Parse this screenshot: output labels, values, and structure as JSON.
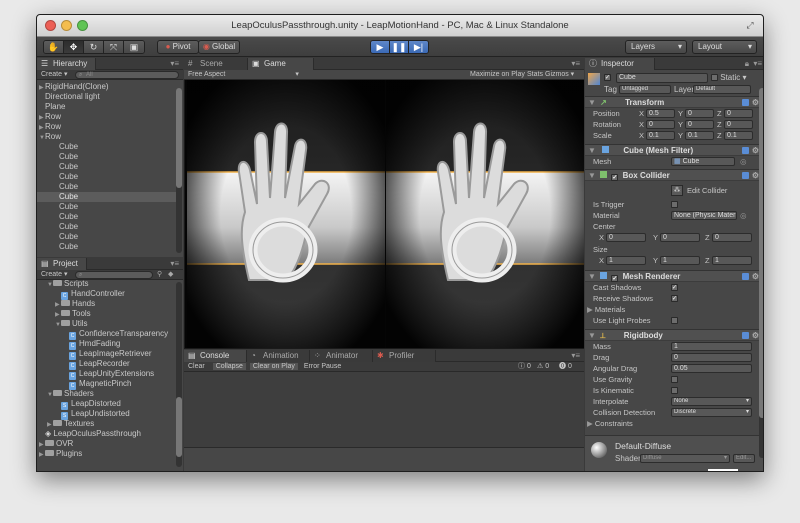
{
  "window": {
    "title": "LeapOculusPassthrough.unity - LeapMotionHand - PC, Mac & Linux Standalone"
  },
  "toolbar": {
    "pivot": "Pivot",
    "global": "Global",
    "layers": "Layers",
    "layout": "Layout",
    "tools": [
      "hand-icon",
      "move-icon",
      "rotate-icon",
      "scale-icon",
      "rect-icon"
    ],
    "play": [
      "play-icon",
      "pause-icon",
      "step-icon"
    ]
  },
  "hierarchy": {
    "tab": "Hierarchy",
    "create": "Create",
    "search_placeholder": "All",
    "items": [
      {
        "label": "RigidHand(Clone)",
        "indent": 0,
        "arrow": "▶",
        "selected": false
      },
      {
        "label": "Directional light",
        "indent": 0,
        "arrow": "",
        "selected": false
      },
      {
        "label": "Plane",
        "indent": 0,
        "arrow": "",
        "selected": false
      },
      {
        "label": "Row",
        "indent": 0,
        "arrow": "▶",
        "selected": false
      },
      {
        "label": "Row",
        "indent": 0,
        "arrow": "▶",
        "selected": false
      },
      {
        "label": "Row",
        "indent": 0,
        "arrow": "▼",
        "selected": false
      },
      {
        "label": "Cube",
        "indent": 1,
        "arrow": "",
        "selected": false
      },
      {
        "label": "Cube",
        "indent": 1,
        "arrow": "",
        "selected": false
      },
      {
        "label": "Cube",
        "indent": 1,
        "arrow": "",
        "selected": false
      },
      {
        "label": "Cube",
        "indent": 1,
        "arrow": "",
        "selected": false
      },
      {
        "label": "Cube",
        "indent": 1,
        "arrow": "",
        "selected": false
      },
      {
        "label": "Cube",
        "indent": 1,
        "arrow": "",
        "selected": true
      },
      {
        "label": "Cube",
        "indent": 1,
        "arrow": "",
        "selected": false
      },
      {
        "label": "Cube",
        "indent": 1,
        "arrow": "",
        "selected": false
      },
      {
        "label": "Cube",
        "indent": 1,
        "arrow": "",
        "selected": false
      },
      {
        "label": "Cube",
        "indent": 1,
        "arrow": "",
        "selected": false
      },
      {
        "label": "Cube",
        "indent": 1,
        "arrow": "",
        "selected": false
      }
    ]
  },
  "project": {
    "tab": "Project",
    "create": "Create",
    "items": [
      {
        "label": "Scripts",
        "depth": 1,
        "arrow": "▼",
        "kind": "folder"
      },
      {
        "label": "HandController",
        "depth": 2,
        "arrow": "",
        "kind": "script"
      },
      {
        "label": "Hands",
        "depth": 2,
        "arrow": "▶",
        "kind": "folder"
      },
      {
        "label": "Tools",
        "depth": 2,
        "arrow": "▶",
        "kind": "folder"
      },
      {
        "label": "Utils",
        "depth": 2,
        "arrow": "▼",
        "kind": "folder"
      },
      {
        "label": "ConfidenceTransparency",
        "depth": 3,
        "arrow": "",
        "kind": "script"
      },
      {
        "label": "HmdFading",
        "depth": 3,
        "arrow": "",
        "kind": "script"
      },
      {
        "label": "LeapImageRetriever",
        "depth": 3,
        "arrow": "",
        "kind": "script"
      },
      {
        "label": "LeapRecorder",
        "depth": 3,
        "arrow": "",
        "kind": "script"
      },
      {
        "label": "LeapUnityExtensions",
        "depth": 3,
        "arrow": "",
        "kind": "script"
      },
      {
        "label": "MagneticPinch",
        "depth": 3,
        "arrow": "",
        "kind": "script"
      },
      {
        "label": "Shaders",
        "depth": 1,
        "arrow": "▼",
        "kind": "folder"
      },
      {
        "label": "LeapDistorted",
        "depth": 2,
        "arrow": "",
        "kind": "shader"
      },
      {
        "label": "LeapUndistorted",
        "depth": 2,
        "arrow": "",
        "kind": "shader"
      },
      {
        "label": "Textures",
        "depth": 1,
        "arrow": "▶",
        "kind": "folder"
      },
      {
        "label": "LeapOculusPassthrough",
        "depth": 0,
        "arrow": "",
        "kind": "unity"
      },
      {
        "label": "OVR",
        "depth": 0,
        "arrow": "▶",
        "kind": "folder"
      },
      {
        "label": "Plugins",
        "depth": 0,
        "arrow": "▶",
        "kind": "folder"
      }
    ]
  },
  "scene_tabs": {
    "scene": "Scene",
    "game": "Game"
  },
  "game_bar": {
    "aspect": "Free Aspect",
    "maximize": "Maximize on Play",
    "stats": "Stats",
    "gizmos": "Gizmos"
  },
  "console": {
    "tabs": [
      "Console",
      "Animation",
      "Animator",
      "Profiler"
    ],
    "buttons": [
      "Clear",
      "Collapse",
      "Clear on Play",
      "Error Pause"
    ],
    "counts": [
      "0",
      "0",
      "0"
    ]
  },
  "inspector": {
    "tab": "Inspector",
    "object": "Cube",
    "static": "Static",
    "tag_label": "Tag",
    "tag_value": "Untagged",
    "layer_label": "Layer",
    "layer_value": "Default",
    "transform": {
      "title": "Transform",
      "position_label": "Position",
      "rotation_label": "Rotation",
      "scale_label": "Scale",
      "position": [
        "0.5",
        "0",
        "0"
      ],
      "rotation": [
        "0",
        "0",
        "0"
      ],
      "scale": [
        "0.1",
        "0.1",
        "0.1"
      ],
      "axes": [
        "X",
        "Y",
        "Z"
      ]
    },
    "mesh_filter": {
      "title": "Cube (Mesh Filter)",
      "mesh_label": "Mesh",
      "mesh_value": "Cube"
    },
    "box_collider": {
      "title": "Box Collider",
      "edit": "Edit Collider",
      "is_trigger": "Is Trigger",
      "material_label": "Material",
      "material_value": "None (Physic Materia",
      "center_label": "Center",
      "center": [
        "0",
        "0",
        "0"
      ],
      "size_label": "Size",
      "size": [
        "1",
        "1",
        "1"
      ]
    },
    "mesh_renderer": {
      "title": "Mesh Renderer",
      "cast_shadows": "Cast Shadows",
      "receive_shadows": "Receive Shadows",
      "materials": "Materials",
      "light_probes": "Use Light Probes"
    },
    "rigidbody": {
      "title": "Rigidbody",
      "mass_label": "Mass",
      "mass": "1",
      "drag_label": "Drag",
      "drag": "0",
      "angular_label": "Angular Drag",
      "angular": "0.05",
      "gravity_label": "Use Gravity",
      "kinematic_label": "Is Kinematic",
      "interpolate_label": "Interpolate",
      "interpolate": "None",
      "collision_label": "Collision Detection",
      "collision": "Discrete",
      "constraints": "Constraints"
    },
    "material": {
      "name": "Default-Diffuse",
      "shader_label": "Shader",
      "shader_value": "Diffuse",
      "edit": "Edit..."
    }
  },
  "colors": {
    "accent": "#3a69b5",
    "panel": "#474747",
    "selection": "#5c5c5c"
  }
}
